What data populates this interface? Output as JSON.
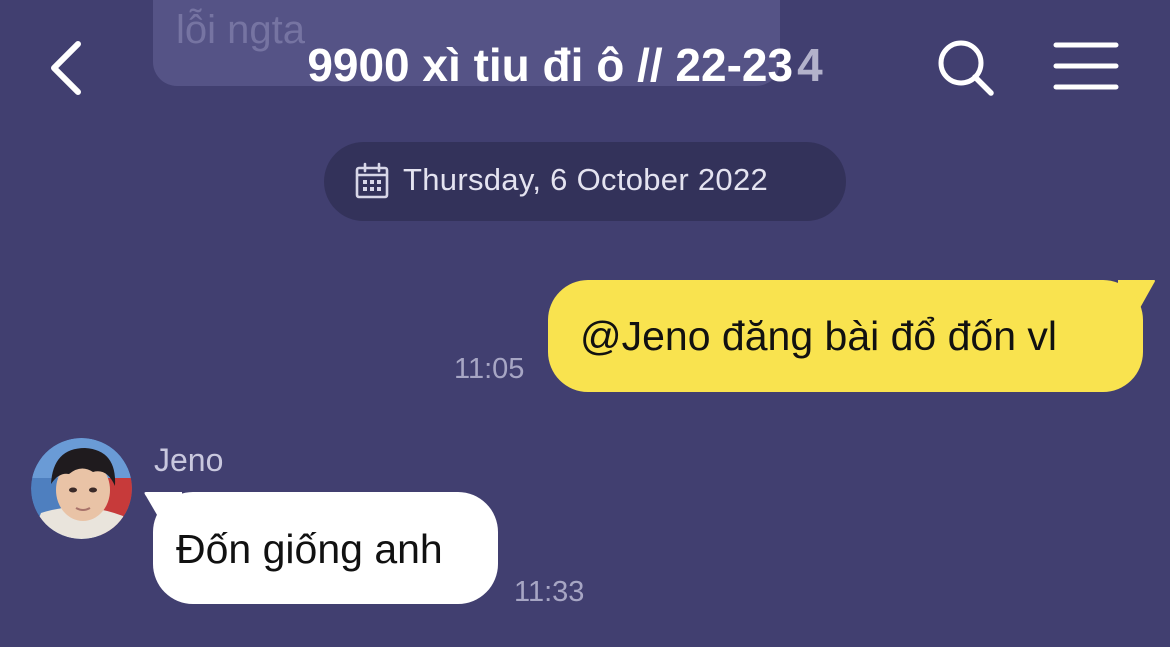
{
  "chat": {
    "previous_message_fragment": "lỗi ngta",
    "title": "9900 xì tiu đi ô // 22-23",
    "member_count": "4"
  },
  "date_divider": {
    "label": "Thursday, 6 October 2022",
    "icon": "calendar-icon"
  },
  "messages": [
    {
      "direction": "outgoing",
      "text": "@Jeno đăng bài đổ đốn vl",
      "time": "11:05"
    },
    {
      "direction": "incoming",
      "sender": "Jeno",
      "text": "Đốn giống anh",
      "time": "11:33"
    }
  ],
  "icons": {
    "back": "chevron-left-icon",
    "search": "search-icon",
    "menu": "hamburger-menu-icon"
  },
  "colors": {
    "background": "#413f70",
    "outgoing_bubble": "#f9e34f",
    "incoming_bubble": "#ffffff",
    "date_pill": "#33325a",
    "timestamp": "#a7a6c4"
  }
}
